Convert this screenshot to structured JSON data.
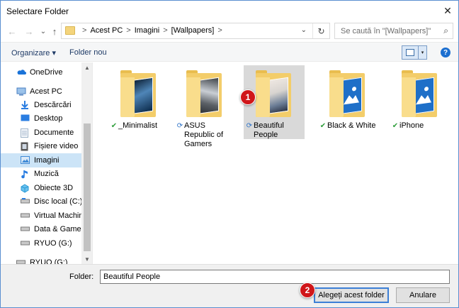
{
  "window": {
    "title": "Selectare Folder",
    "close_glyph": "✕"
  },
  "nav": {
    "back_glyph": "←",
    "forward_glyph": "→",
    "recent_glyph": "⌄",
    "up_glyph": "↑",
    "breadcrumbs": [
      "Acest PC",
      "Imagini",
      "[Wallpapers]"
    ],
    "crumb_sep": ">",
    "dropdown_glyph": "⌄",
    "refresh_glyph": "↻",
    "search_placeholder": "Se caută în \"[Wallpapers]\"",
    "search_glyph": "⌕"
  },
  "commandbar": {
    "organize": "Organizare ▾",
    "new_folder": "Folder nou",
    "view_dropdown_glyph": "▾",
    "help_glyph": "?"
  },
  "sidebar": {
    "items": [
      {
        "label": "OneDrive",
        "icon": "cloud-icon",
        "color": "#1a73d8"
      },
      {
        "label": "Acest PC",
        "icon": "computer-icon",
        "color": "#4a7fc1"
      },
      {
        "label": "Descărcări",
        "icon": "download-icon",
        "color": "#2a7de1"
      },
      {
        "label": "Desktop",
        "icon": "desktop-icon",
        "color": "#2a7de1"
      },
      {
        "label": "Documente",
        "icon": "documents-icon",
        "color": "#9fb3c8"
      },
      {
        "label": "Fișiere video",
        "icon": "video-icon",
        "color": "#6a6a6a"
      },
      {
        "label": "Imagini",
        "icon": "pictures-icon",
        "color": "#3e8ad6"
      },
      {
        "label": "Muzică",
        "icon": "music-icon",
        "color": "#2a7de1"
      },
      {
        "label": "Obiecte 3D",
        "icon": "objects3d-icon",
        "color": "#2a9bd6"
      },
      {
        "label": "Disc local (C:)",
        "icon": "drive-icon",
        "color": "#7a7a7a"
      },
      {
        "label": "Virtual Machines",
        "icon": "drive-icon",
        "color": "#7a7a7a"
      },
      {
        "label": "Data & Games (E",
        "icon": "drive-icon",
        "color": "#7a7a7a"
      },
      {
        "label": "RYUO (G:)",
        "icon": "drive-icon",
        "color": "#7a7a7a"
      },
      {
        "label": "RYUO (G:)",
        "icon": "drive-icon",
        "color": "#7a7a7a"
      }
    ],
    "selected_index": 6,
    "scroll_up_glyph": "▲",
    "scroll_down_glyph": "▼"
  },
  "folders": [
    {
      "name": "_Minimalist",
      "status": "ok",
      "status_glyph": "✔",
      "image_colors": [
        "#0b2a4a",
        "#4f86b8",
        "#0a1c30"
      ]
    },
    {
      "name": "ASUS Republic of Gamers",
      "status": "sync",
      "status_glyph": "⟳",
      "image_colors": [
        "#5b6066",
        "#c9ced4",
        "#3d4248"
      ]
    },
    {
      "name": "Beautiful People",
      "status": "sync",
      "status_glyph": "⟳",
      "image_colors": [
        "#d8d4d0",
        "#6b7d96",
        "#efe8e2"
      ]
    },
    {
      "name": "Black & White",
      "status": "ok",
      "status_glyph": "✔",
      "image_colors": [
        "#1e6fc8",
        "#ffffff",
        "#2a82e0"
      ]
    },
    {
      "name": "iPhone",
      "status": "ok",
      "status_glyph": "✔",
      "image_colors": [
        "#1e6fc8",
        "#ffffff",
        "#2a82e0"
      ]
    }
  ],
  "selected_folder_index": 2,
  "annotations": [
    "1",
    "2"
  ],
  "footer": {
    "folder_label": "Folder:",
    "folder_value": "Beautiful People",
    "select_button": "Alegeți acest folder",
    "cancel_button": "Anulare"
  },
  "colors": {
    "accent": "#3c7fd6",
    "selection": "#cce4f7",
    "badge": "#d0161a"
  }
}
